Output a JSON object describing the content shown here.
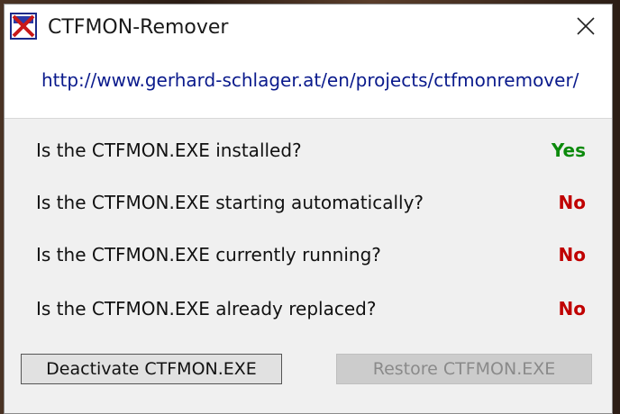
{
  "window": {
    "title": "CTFMON-Remover",
    "icon": "ctfmon-remover-app-icon",
    "close_icon": "close-icon"
  },
  "header": {
    "url": "http://www.gerhard-schlager.at/en/projects/ctfmonremover/"
  },
  "status": [
    {
      "question": "Is the CTFMON.EXE installed?",
      "answer": "Yes",
      "color": "#0c8a0c"
    },
    {
      "question": "Is the CTFMON.EXE starting automatically?",
      "answer": "No",
      "color": "#c00000"
    },
    {
      "question": "Is the CTFMON.EXE currently running?",
      "answer": "No",
      "color": "#c00000"
    },
    {
      "question": "Is the CTFMON.EXE already replaced?",
      "answer": "No",
      "color": "#c00000"
    }
  ],
  "buttons": {
    "deactivate_label": "Deactivate CTFMON.EXE",
    "restore_label": "Restore CTFMON.EXE",
    "restore_enabled": false
  }
}
